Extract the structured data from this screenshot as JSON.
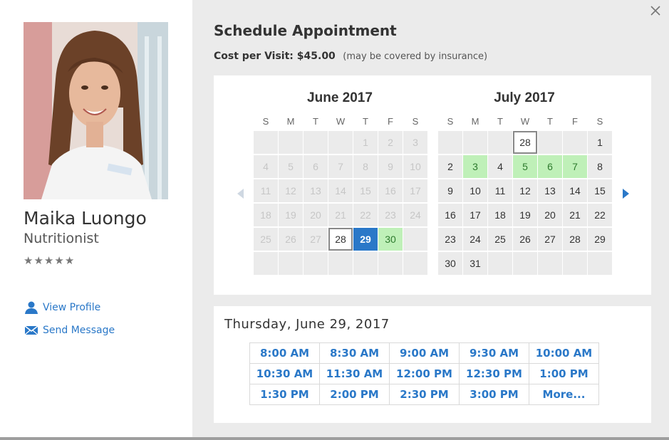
{
  "provider": {
    "name": "Maika Luongo",
    "title": "Nutritionist",
    "rating_stars": 5,
    "links": {
      "view_profile": "View Profile",
      "send_message": "Send Message"
    }
  },
  "schedule": {
    "title": "Schedule Appointment",
    "cost_label": "Cost per Visit: $45.00",
    "cost_note": "(may be covered by insurance)"
  },
  "calendar": {
    "weekday_labels": [
      "S",
      "M",
      "T",
      "W",
      "T",
      "F",
      "S"
    ],
    "months": [
      {
        "title": "June 2017",
        "days": [
          {
            "d": "",
            "s": "empty"
          },
          {
            "d": "",
            "s": "empty"
          },
          {
            "d": "",
            "s": "empty"
          },
          {
            "d": "",
            "s": "empty"
          },
          {
            "d": "1",
            "s": "dim"
          },
          {
            "d": "2",
            "s": "dim"
          },
          {
            "d": "3",
            "s": "dim"
          },
          {
            "d": "4",
            "s": "dim"
          },
          {
            "d": "5",
            "s": "dim"
          },
          {
            "d": "6",
            "s": "dim"
          },
          {
            "d": "7",
            "s": "dim"
          },
          {
            "d": "8",
            "s": "dim"
          },
          {
            "d": "9",
            "s": "dim"
          },
          {
            "d": "10",
            "s": "dim"
          },
          {
            "d": "11",
            "s": "dim"
          },
          {
            "d": "12",
            "s": "dim"
          },
          {
            "d": "13",
            "s": "dim"
          },
          {
            "d": "14",
            "s": "dim"
          },
          {
            "d": "15",
            "s": "dim"
          },
          {
            "d": "16",
            "s": "dim"
          },
          {
            "d": "17",
            "s": "dim"
          },
          {
            "d": "18",
            "s": "dim"
          },
          {
            "d": "19",
            "s": "dim"
          },
          {
            "d": "20",
            "s": "dim"
          },
          {
            "d": "21",
            "s": "dim"
          },
          {
            "d": "22",
            "s": "dim"
          },
          {
            "d": "23",
            "s": "dim"
          },
          {
            "d": "24",
            "s": "dim"
          },
          {
            "d": "25",
            "s": "dim"
          },
          {
            "d": "26",
            "s": "dim"
          },
          {
            "d": "27",
            "s": "dim"
          },
          {
            "d": "28",
            "s": "today"
          },
          {
            "d": "29",
            "s": "selected"
          },
          {
            "d": "30",
            "s": "avail"
          },
          {
            "d": "",
            "s": "empty"
          },
          {
            "d": "",
            "s": "empty"
          },
          {
            "d": "",
            "s": "empty"
          },
          {
            "d": "",
            "s": "empty"
          },
          {
            "d": "",
            "s": "empty"
          },
          {
            "d": "",
            "s": "empty"
          },
          {
            "d": "",
            "s": "empty"
          },
          {
            "d": "",
            "s": "empty"
          }
        ]
      },
      {
        "title": "July 2017",
        "days": [
          {
            "d": "",
            "s": "empty"
          },
          {
            "d": "",
            "s": "empty"
          },
          {
            "d": "",
            "s": "empty"
          },
          {
            "d": "28",
            "s": "today"
          },
          {
            "d": "",
            "s": "empty"
          },
          {
            "d": "",
            "s": "empty"
          },
          {
            "d": "1",
            "s": "normal"
          },
          {
            "d": "2",
            "s": "normal"
          },
          {
            "d": "3",
            "s": "avail"
          },
          {
            "d": "4",
            "s": "normal"
          },
          {
            "d": "5",
            "s": "avail"
          },
          {
            "d": "6",
            "s": "avail"
          },
          {
            "d": "7",
            "s": "avail"
          },
          {
            "d": "8",
            "s": "normal"
          },
          {
            "d": "9",
            "s": "normal"
          },
          {
            "d": "10",
            "s": "normal"
          },
          {
            "d": "11",
            "s": "normal"
          },
          {
            "d": "12",
            "s": "normal"
          },
          {
            "d": "13",
            "s": "normal"
          },
          {
            "d": "14",
            "s": "normal"
          },
          {
            "d": "15",
            "s": "normal"
          },
          {
            "d": "16",
            "s": "normal"
          },
          {
            "d": "17",
            "s": "normal"
          },
          {
            "d": "18",
            "s": "normal"
          },
          {
            "d": "19",
            "s": "normal"
          },
          {
            "d": "20",
            "s": "normal"
          },
          {
            "d": "21",
            "s": "normal"
          },
          {
            "d": "22",
            "s": "normal"
          },
          {
            "d": "23",
            "s": "normal"
          },
          {
            "d": "24",
            "s": "normal"
          },
          {
            "d": "25",
            "s": "normal"
          },
          {
            "d": "26",
            "s": "normal"
          },
          {
            "d": "27",
            "s": "normal"
          },
          {
            "d": "28",
            "s": "normal"
          },
          {
            "d": "29",
            "s": "normal"
          },
          {
            "d": "30",
            "s": "normal"
          },
          {
            "d": "31",
            "s": "normal"
          },
          {
            "d": "",
            "s": "empty"
          },
          {
            "d": "",
            "s": "empty"
          },
          {
            "d": "",
            "s": "empty"
          },
          {
            "d": "",
            "s": "empty"
          },
          {
            "d": "",
            "s": "empty"
          }
        ]
      }
    ]
  },
  "times": {
    "date_heading": "Thursday, June 29, 2017",
    "slots": [
      [
        "8:00 AM",
        "8:30 AM",
        "9:00 AM",
        "9:30 AM",
        "10:00 AM"
      ],
      [
        "10:30 AM",
        "11:30 AM",
        "12:00 PM",
        "12:30 PM",
        "1:00 PM"
      ],
      [
        "1:30 PM",
        "2:00 PM",
        "2:30 PM",
        "3:00 PM",
        "More..."
      ]
    ]
  },
  "colors": {
    "accent": "#2a78c8",
    "available": "#bff0b8",
    "available_text": "#2d7a2d",
    "panel_bg": "#ebebeb"
  },
  "icons": {
    "close": "close-icon",
    "prev": "chevron-left-icon",
    "next": "chevron-right-icon",
    "profile": "person-icon",
    "message": "envelope-icon",
    "star": "star-icon"
  }
}
